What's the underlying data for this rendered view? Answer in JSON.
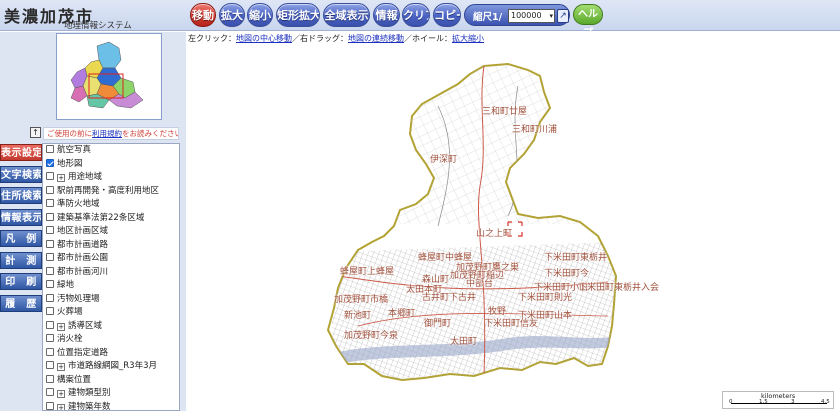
{
  "header": {
    "logo_title": "美濃加茂市",
    "logo_subtitle": "地理情報システム",
    "toolbar": [
      {
        "label": "移動",
        "active": true
      },
      {
        "label": "拡大",
        "active": false
      },
      {
        "label": "縮小",
        "active": false
      },
      {
        "label": "矩形拡大",
        "active": false
      },
      {
        "label": "全域表示",
        "active": false
      },
      {
        "label": "情報",
        "active": false
      },
      {
        "label": "クリア",
        "active": false
      },
      {
        "label": "コピー",
        "active": false
      }
    ],
    "scale_label": "縮尺1/",
    "scale_value": "100000",
    "scale_go_icon": "arrow-icon",
    "green_button_label": "ヘルプ"
  },
  "notice": {
    "prefix": "ご使用の前に",
    "link": "利用規約",
    "suffix": "をお読みください"
  },
  "side_tabs": [
    {
      "label": "表示設定",
      "active": true
    },
    {
      "label": "文字検索",
      "active": false
    },
    {
      "label": "住所検索",
      "active": false
    },
    {
      "label": "情報表示",
      "active": false
    },
    {
      "label": "凡　例",
      "active": false
    },
    {
      "label": "計　測",
      "active": false
    },
    {
      "label": "印　刷",
      "active": false
    },
    {
      "label": "履　歴",
      "active": false
    }
  ],
  "layers": [
    {
      "label": "航空写真",
      "checked": false,
      "expandable": false
    },
    {
      "label": "地形図",
      "checked": true,
      "expandable": false
    },
    {
      "label": "用途地域",
      "checked": false,
      "expandable": true
    },
    {
      "label": "駅前再開発・高度利用地区",
      "checked": false,
      "expandable": false
    },
    {
      "label": "準防火地域",
      "checked": false,
      "expandable": false
    },
    {
      "label": "建築基準法第22条区域",
      "checked": false,
      "expandable": false
    },
    {
      "label": "地区計画区域",
      "checked": false,
      "expandable": false
    },
    {
      "label": "都市計画道路",
      "checked": false,
      "expandable": false
    },
    {
      "label": "都市計画公園",
      "checked": false,
      "expandable": false
    },
    {
      "label": "都市計画河川",
      "checked": false,
      "expandable": false
    },
    {
      "label": "緑地",
      "checked": false,
      "expandable": false
    },
    {
      "label": "汚物処理場",
      "checked": false,
      "expandable": false
    },
    {
      "label": "火葬場",
      "checked": false,
      "expandable": false
    },
    {
      "label": "誘導区域",
      "checked": false,
      "expandable": true
    },
    {
      "label": "消火栓",
      "checked": false,
      "expandable": false
    },
    {
      "label": "位置指定道路",
      "checked": false,
      "expandable": false
    },
    {
      "label": "市道路線網図_R3年3月",
      "checked": false,
      "expandable": true
    },
    {
      "label": "構案位置",
      "checked": false,
      "expandable": false
    },
    {
      "label": "建物類型別",
      "checked": false,
      "expandable": true
    },
    {
      "label": "建物築年数",
      "checked": false,
      "expandable": true
    }
  ],
  "instructions": {
    "left_click": "左クリック：",
    "left_click_link": "地図の中心移動",
    "right_drag": "／右ドラッグ：",
    "right_drag_link": "地図の連続移動",
    "wheel": "／ホイール：",
    "wheel_link": "拡大縮小"
  },
  "map_labels": [
    "三和町廿屋",
    "三和町川浦",
    "伊深町",
    "山之上町",
    "蜂屋町中蜂屋",
    "加茂野町鷹之巣",
    "蜂屋町上蜂屋",
    "森山町",
    "太田本町",
    "加茂野町市橋",
    "下米田町東栃井",
    "下米田町今",
    "下米田町小山",
    "下米田町則光",
    "古井町下古井",
    "本郷町",
    "御門町",
    "太田町",
    "下米田町山本",
    "新池町",
    "中部台",
    "加茂野町今泉",
    "牧野",
    "下米田町信友",
    "下米田町東栃井入会",
    "加茂野町稲辺"
  ],
  "scalebar": {
    "title": "kilometers",
    "ticks": [
      "0",
      "1.5",
      "3",
      "4.5"
    ]
  }
}
